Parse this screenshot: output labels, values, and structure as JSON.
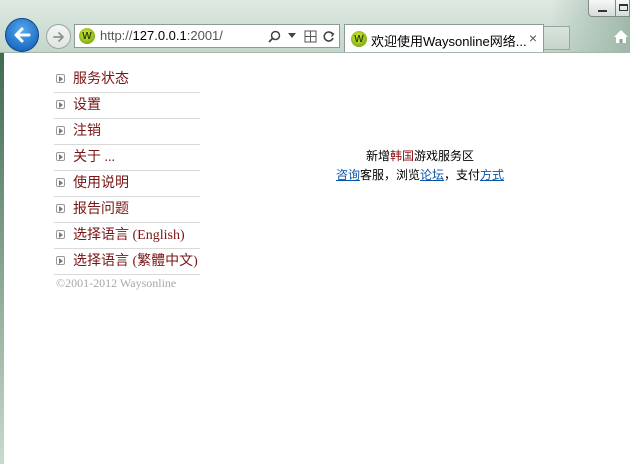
{
  "browser": {
    "address": {
      "url_prefix": "http://",
      "url_host": "127.0.0.1",
      "url_suffix": ":2001/"
    },
    "tab": {
      "title": "欢迎使用Waysonline网络...",
      "close_glyph": "×"
    },
    "favicon_letter": "W"
  },
  "menu": {
    "items": [
      {
        "label": "服务状态"
      },
      {
        "label": "设置"
      },
      {
        "label": "注销"
      },
      {
        "label": "关于 ..."
      },
      {
        "label": "使用说明"
      },
      {
        "label": "报告问题"
      },
      {
        "label": "选择语言 (English)"
      },
      {
        "label": "选择语言 (繁體中文)"
      }
    ]
  },
  "footer": {
    "copyright": "©2001-2012 Waysonline"
  },
  "notice": {
    "line1_pre": "新增",
    "line1_highlight": "韩国",
    "line1_post": "游戏服务区",
    "link_consult": "咨询",
    "text_service": "客服，浏览",
    "link_forum": "论坛",
    "text_pay": "，支付",
    "link_method": "方式"
  },
  "colors": {
    "menu_link": "#7a1515",
    "notice_link": "#0b55a8",
    "highlight": "#8a1010"
  }
}
